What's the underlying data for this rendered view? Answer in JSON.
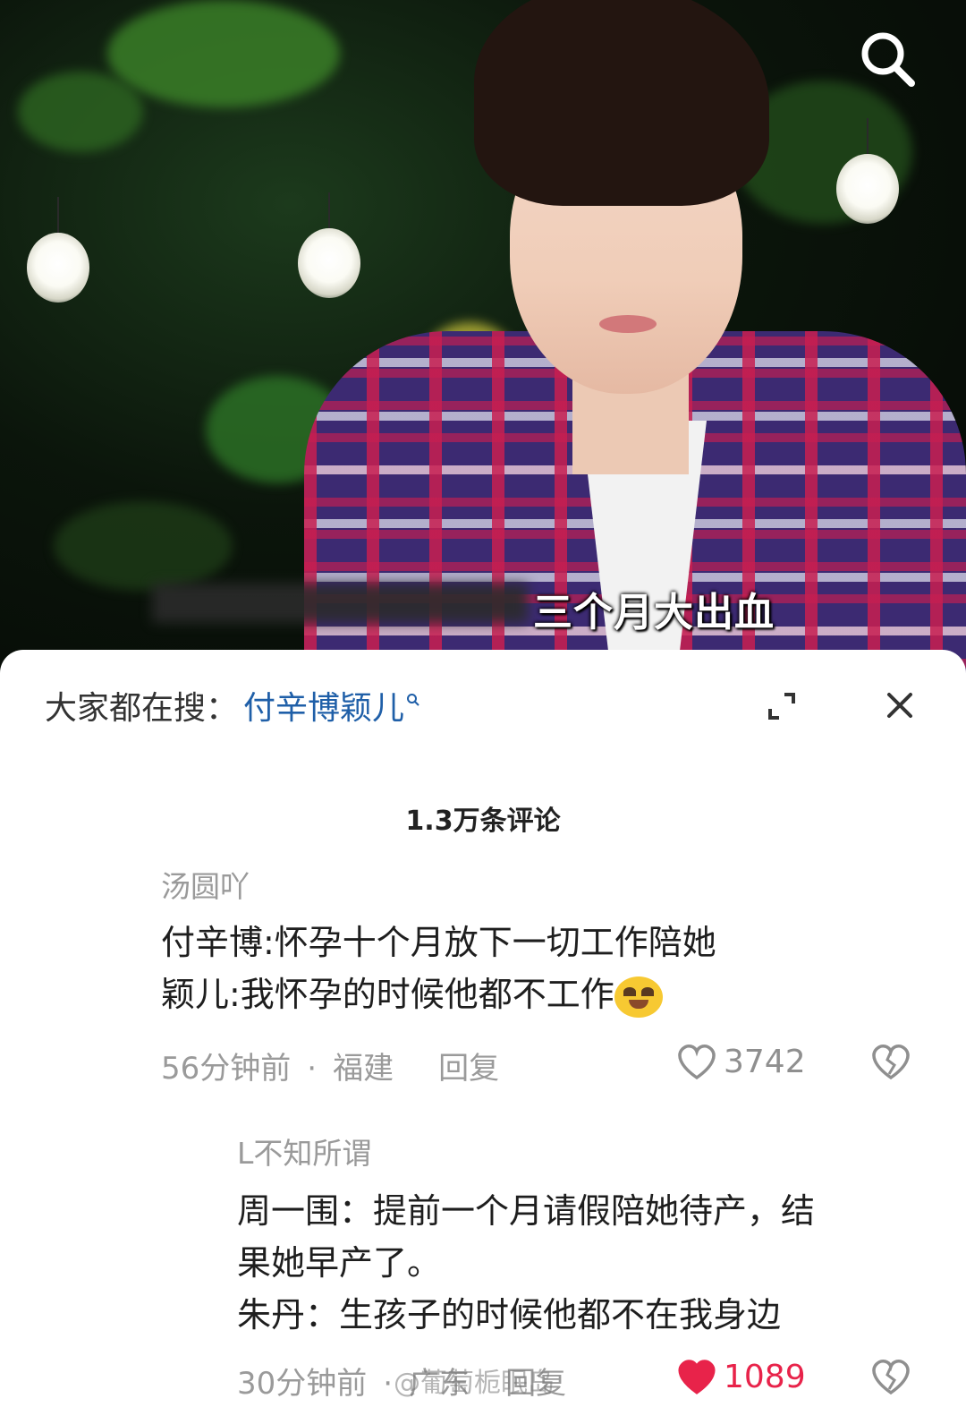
{
  "video": {
    "caption": "三个月大出血"
  },
  "trending": {
    "prefix": "大家都在搜：",
    "term": "付辛博颖儿"
  },
  "comments_header": {
    "count_label": "1.3万条评论"
  },
  "comments": [
    {
      "username": "汤圆吖",
      "lines": [
        "付辛博:怀孕十个月放下一切工作陪她",
        "颖儿:我怀孕的时候他都不工作"
      ],
      "time": "56分钟前",
      "location": "福建",
      "reply_label": "回复",
      "likes": "3742",
      "liked": false
    },
    {
      "username": "L不知所谓",
      "lines": [
        "周一围：提前一个月请假陪她待产，结",
        "果她早产了。",
        "朱丹：生孩子的时候他都不在我身边"
      ],
      "time": "30分钟前",
      "location": "广东",
      "reply_label": "回复",
      "likes": "1089",
      "liked": true
    }
  ],
  "watermark": "@葡萄栀眠岛",
  "colors": {
    "link_blue": "#1f5fa8",
    "like_red": "#e8234a",
    "muted_gray": "#9a9a9a"
  },
  "icons": [
    "search-icon",
    "expand-icon",
    "close-icon",
    "heart-icon",
    "broken-heart-icon",
    "crying-laugh-emoji"
  ]
}
